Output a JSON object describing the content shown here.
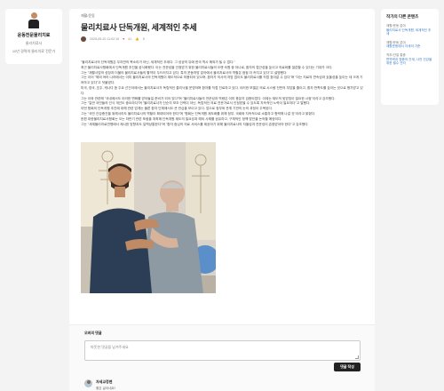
{
  "profile": {
    "name": "운동전문물리치료",
    "role": "물리치료사",
    "desc": "10년 경력의 물리치료 전문가"
  },
  "article": {
    "breadcrumb": "재활/운동",
    "title": "물리치료사 단독개원, 세계적인 추세",
    "date": "2025-05-20 11:02:10",
    "likes": "41",
    "thumbs": "5",
    "paragraphs": [
      "\"물리치료사의 단독개원은 우리만의 목소리가 아닌, 세계적인 추세다. 그 성공의 뒤에 한국 역시 예외가 될 수 없다.\"",
      "최근 물리치료사협회에서 단독개원 추진을 공식화했다. 이는 전문성을 인정받기 위한 물리치료사들의 오랜 숙원 중 하나로, 환자의 접근성을 높이고 의료비를 절감할 수 있다는 기대가 크다.",
      "그는 \"재활사업의 성장과 더불어 물리치료사들의 활약이 두드러지고 있다. 특히 운동처방 분야에서 물리치료사의 역할은 점점 더 커지고 있다\"고 설명했다.",
      "그는 이어 \"해외 여러 나라에서는 이미 물리치료사의 단독개원이 제도적으로 허용되어 있으며, 환자가 의사의 처방 없이도 물리치료사를 직접 찾아갈 수 있다\"며 \"이는 치료의 연속성과 효율성을 높이는 데 크게 기여하고 있다\"고 덧붙였다.",
      "미국, 영국, 호주, 캐나다 등 주요 선진국에서는 물리치료사가 독립적인 클리닉을 운영하며 환자를 직접 진료하고 있다. 이러한 모델은 의료 시스템 전반의 부담을 줄이고, 환자 만족도를 높이는 것으로 평가받고 있다.",
      "그는 이와 관련해 \"국내에서도 이러한 변화를 받아들일 준비가 되어 있다\"며 \"물리치료사들의 전문성과 역량은 이미 충분히 검증되었다. 이제는 제도적 뒷받침이 필요한 시점\"이라고 강조했다.",
      "그는 \"일반 국민들의 인식 개선도 중요하다\"며 \"물리치료사가 단순히 보조 인력이 아닌, 독립적인 의료 전문가로서 인정받을 수 있도록 지속적인 노력이 필요하다\"고 말했다.",
      "이번 협회의 단독개원 추진에 대해 관련 업계는 물론 환자 단체에서도 큰 관심을 보이고 있다. 앞으로 정부와 관계 기관의 논의 과정이 주목된다.",
      "그는 \"국민 건강증진을 위해서라도 물리치료사의 역할이 확대되어야 한다\"며 \"협회는 단독개원 제도화를 위해 정부, 국회와 지속적으로 소통하고 협력해 나갈 것\"이라고 밝혔다.",
      "한편 대한물리치료사협회는 오는 하반기 관련 포럼을 개최해 단독개원 제도의 필요성과 해외 사례를 공유하고, 구체적인 정책 방안을 논의할 예정이다.",
      "그는 \"세계물리치료연맹에서 제시한 방향과도 일맥상통한다\"며 \"환자 중심의 의료 서비스를 제공하기 위해 물리치료사의 자율성과 전문성이 존중받아야 한다\"고 강조했다."
    ]
  },
  "comments": {
    "label": "오버의 댓글",
    "placeholder": "따뜻한 댓글을 남겨주세요",
    "submit_label": "댓글 작성",
    "first": {
      "author": "자세교정맨",
      "text": "좋은 글이네요!"
    }
  },
  "related": {
    "heading": "작가의 다른 콘텐츠",
    "items": [
      {
        "category": "재활/운동 분야",
        "title": "물리치료사 단독개원, 세계적인 추세"
      },
      {
        "category": "재활/운동 분야",
        "title": "재활운동에서 자세의 기준"
      },
      {
        "category": "척추/관절 통증",
        "title": "면역력과 염증의 관계, 사전 건강을 위한 필수 관리"
      }
    ]
  },
  "colors": {
    "accent": "#3a7cc6",
    "button": "#222222"
  }
}
